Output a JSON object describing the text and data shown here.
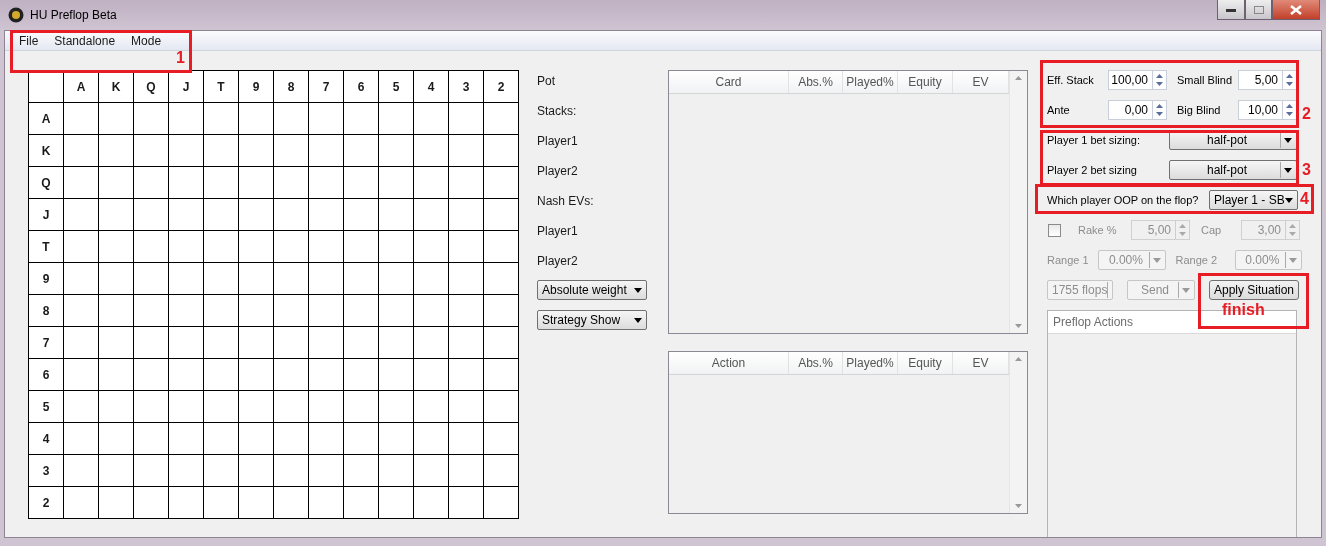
{
  "window": {
    "title": "HU Preflop Beta"
  },
  "menu": [
    {
      "label": "File"
    },
    {
      "label": "Standalone"
    },
    {
      "label": "Mode"
    }
  ],
  "grid": {
    "columns": [
      "A",
      "K",
      "Q",
      "J",
      "T",
      "9",
      "8",
      "7",
      "6",
      "5",
      "4",
      "3",
      "2"
    ],
    "rows": [
      "A",
      "K",
      "Q",
      "J",
      "T",
      "9",
      "8",
      "7",
      "6",
      "5",
      "4",
      "3",
      "2"
    ]
  },
  "info_labels": [
    "Pot",
    "Stacks:",
    "Player1",
    "Player2",
    "Nash EVs:",
    "Player1",
    "Player2"
  ],
  "view_dropdowns": [
    {
      "value": "Absolute weight"
    },
    {
      "value": "Strategy Show"
    }
  ],
  "tables": [
    {
      "columns": [
        "Card",
        "Abs.%",
        "Played%",
        "Equity",
        "EV"
      ]
    },
    {
      "columns": [
        "Action",
        "Abs.%",
        "Played%",
        "Equity",
        "EV"
      ]
    }
  ],
  "stakes": [
    {
      "label": "Eff. Stack",
      "value": "100,00"
    },
    {
      "label": "Small Blind",
      "value": "5,00"
    },
    {
      "label": "Ante",
      "value": "0,00"
    },
    {
      "label": "Big Blind",
      "value": "10,00"
    }
  ],
  "bet_sizing": [
    {
      "label": "Player 1 bet sizing:",
      "value": "half-pot"
    },
    {
      "label": "Player 2 bet sizing",
      "value": "half-pot"
    }
  ],
  "oop": {
    "label": "Which player OOP on the flop?",
    "value": "Player 1 - SB"
  },
  "rake": {
    "checked": false,
    "disabled": true,
    "fields": [
      {
        "label": "Rake %",
        "value": "5,00"
      },
      {
        "label": "Cap",
        "value": "3,00"
      }
    ]
  },
  "ranges": {
    "disabled": true,
    "fields": [
      {
        "label": "Range 1",
        "value": "0.00%"
      },
      {
        "label": "Range 2",
        "value": "0.00%"
      }
    ]
  },
  "actions": {
    "flops": {
      "value": "1755 flops",
      "disabled": true
    },
    "send": {
      "value": "Send",
      "disabled": true
    },
    "apply": {
      "label": "Apply Situation",
      "disabled": false
    }
  },
  "preflop_actions": {
    "title": "Preflop Actions"
  },
  "annotations": [
    {
      "label": "1"
    },
    {
      "label": "2"
    },
    {
      "label": "3"
    },
    {
      "label": "4"
    },
    {
      "label": "finish"
    }
  ]
}
